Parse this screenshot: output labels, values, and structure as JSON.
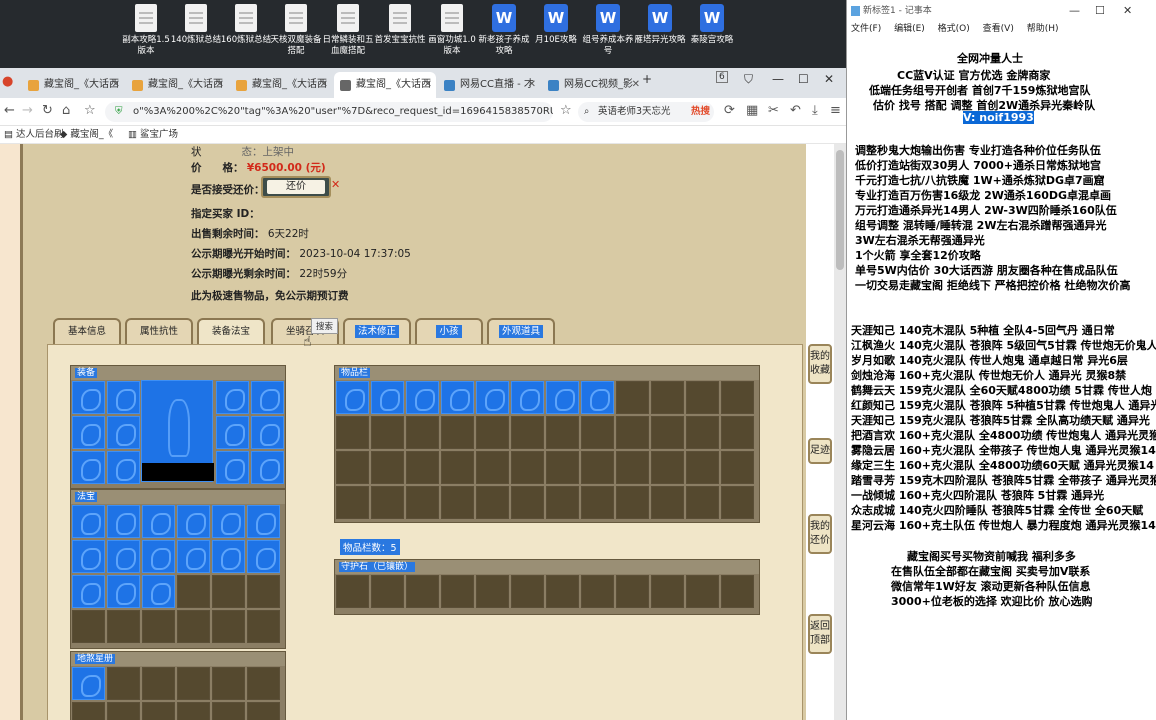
{
  "desktop": {
    "icons": [
      {
        "label": "副本攻略1.5版本",
        "kind": "doc"
      },
      {
        "label": "140炼狱总结",
        "kind": "doc"
      },
      {
        "label": "160炼狱总结",
        "kind": "doc"
      },
      {
        "label": "天核双魔装备搭配",
        "kind": "doc"
      },
      {
        "label": "日常鳞装和五血魔搭配",
        "kind": "doc"
      },
      {
        "label": "首发宝宝抗性",
        "kind": "doc"
      },
      {
        "label": "画窗功城1.0版本",
        "kind": "doc"
      },
      {
        "label": "新老孩子养成攻略",
        "kind": "wps"
      },
      {
        "label": "月10E攻略",
        "kind": "wps"
      },
      {
        "label": "组号养成本养号",
        "kind": "wps"
      },
      {
        "label": "雁塔异光攻略",
        "kind": "wps"
      },
      {
        "label": "秦陵宫攻略",
        "kind": "wps"
      }
    ]
  },
  "browser": {
    "tabs": [
      {
        "label": "藏宝阁_《大话西",
        "active": false
      },
      {
        "label": "藏宝阁_《大话西",
        "active": false
      },
      {
        "label": "藏宝阁_《大话西",
        "active": false
      },
      {
        "label": "藏宝阁_《大话西",
        "active": true
      },
      {
        "label": "网易CC直播 - 才",
        "active": false
      },
      {
        "label": "网易CC视频_影",
        "active": false
      }
    ],
    "tab_count": "6",
    "url": "o\"%3A%200%2C%20\"tag\"%3A%20\"user\"%7D&reco_request_id=1696415838570RUbxu",
    "search_text": "英语老师3天忘光",
    "search_badge": "热搜",
    "bookmarks": [
      "达人后台刷",
      "藏宝阁_《",
      "鲨宝广场"
    ]
  },
  "listing": {
    "status_label": "状",
    "status_value": "态：上架中",
    "price_label": "价　　格：",
    "price_value": "¥6500.00 (元)",
    "haggle_label": "是否接受还价：",
    "haggle_button": "还价",
    "buyer_label": "指定买家 ID：",
    "remaining_label": "出售剩余时间：",
    "remaining_value": "6天22时",
    "public_start_label": "公示期曝光开始时间：",
    "public_start_value": "2023-10-04 17:37:05",
    "public_remain_label": "公示期曝光剩余时间：",
    "public_remain_value": "22时59分",
    "fast_sale_note": "此为极速售物品，免公示期预订费"
  },
  "game_tabs": [
    {
      "label": "基本信息",
      "selected": false
    },
    {
      "label": "属性抗性",
      "selected": false
    },
    {
      "label": "装备法宝",
      "selected": false,
      "active": true
    },
    {
      "label": "坐骑召唤",
      "selected": false
    },
    {
      "label": "法术修正",
      "selected": true
    },
    {
      "label": "小孩",
      "selected": true
    },
    {
      "label": "外观道具",
      "selected": true
    }
  ],
  "tooltip": "搜索",
  "sections": {
    "equipment": "装备",
    "treasure": "法宝",
    "pet_book": "地煞星册",
    "inventory": "物品栏",
    "inventory_count": "物品栏数：5",
    "guard_stone": "守护石（已镶嵌）"
  },
  "side_buttons": [
    "我的收藏",
    "足迹",
    "我的还价",
    "返回顶部"
  ],
  "notepad": {
    "title": "新标签1 - 记事本",
    "menu": [
      "文件(F)",
      "编辑(E)",
      "格式(O)",
      "查看(V)",
      "帮助(H)"
    ],
    "lines": [
      {
        "text": "全网冲量人士",
        "highlight": false
      },
      {
        "text": "CC蓝V认证 官方优选 金牌商家",
        "highlight": false
      },
      {
        "text": "低端任务组号开创者          首创7千159炼狱地宫队",
        "highlight": false
      },
      {
        "text": "估价 找号 搭配 调整          首创2W通杀异光秦岭队",
        "highlight": false
      },
      {
        "text": "V: noif1993",
        "highlight": true
      },
      {
        "text": "调整秒鬼大炮输出伤害              专业打造各种价位任务队伍",
        "highlight": false
      },
      {
        "text": "低价打造站街双30男人              7000+通杀日常炼狱地宫",
        "highlight": false
      },
      {
        "text": "千元打造七抗/八抗铁魔            1W+通杀炼狱DG卓7画窟",
        "highlight": false
      },
      {
        "text": "专业打造百万伤害16级龙            2W通杀160DG卓混卓画",
        "highlight": false
      },
      {
        "text": "万元打造通杀异光14男人          2W-3W四阶睡杀160队伍",
        "highlight": false
      },
      {
        "text": "组号调整 混转睡/睡转混            2W左右混杀蹭帮强通异光",
        "highlight": false
      },
      {
        "text": "                                                3W左右混杀无帮强通异光",
        "highlight": false
      },
      {
        "text": "1个火箭 享全套12价攻略",
        "highlight": false
      },
      {
        "text": "单号5W内估价 30大话西游            朋友圈各种在售成品队伍",
        "highlight": false
      },
      {
        "text": "一切交易走藏宝阁 拒绝线下      严格把控价格 杜绝物次价高",
        "highlight": false
      },
      {
        "text": "天涯知己 140克木混队 5种植 全队4-5回气丹 通日常",
        "highlight": false
      },
      {
        "text": "江枫渔火 140克火混队 苍狼阵 5级回气5甘霖 传世炮无价鬼人",
        "highlight": false
      },
      {
        "text": "岁月如歌 140克火混队 传世人炮鬼 通卓越日常 异光6层",
        "highlight": false
      },
      {
        "text": "剑烛沧海 160+克火混队 传世炮无价人 通异光 灵猴8禁",
        "highlight": false
      },
      {
        "text": "鹤舞云天 159克火混队 全60天赋4800功绩 5甘霖 传世人炮",
        "highlight": false
      },
      {
        "text": "红颜知己 159克火混队 苍狼阵 5种植5甘霖 传世炮鬼人 通异光",
        "highlight": false
      },
      {
        "text": "天涯知己 159克火混队 苍狼阵5甘霖 全队高功绩天赋 通异光",
        "highlight": false
      },
      {
        "text": "把酒言欢 160+克火混队 全4800功绩 传世炮鬼人 通异光灵猴",
        "highlight": false
      },
      {
        "text": "雾隐云居 160+克火混队 全带孩子 传世炮人鬼 通异光灵猴14",
        "highlight": false
      },
      {
        "text": "缘定三生 160+克火混队 全4800功绩60天赋 通异光灵猴14",
        "highlight": false
      },
      {
        "text": "踏雪寻芳 159克木四阶混队 苍狼阵5甘霖 全带孩子 通异光灵猴",
        "highlight": false
      },
      {
        "text": "一战倾城 160+克火四阶混队 苍狼阵 5甘霖 通异光",
        "highlight": false
      },
      {
        "text": "众志成城 140克火四阶睡队 苍狼阵5甘霖 全传世 全60天赋",
        "highlight": false
      },
      {
        "text": "星河云海 160+克土队伍 传世炮人 暴力程度炮 通异光灵猴14",
        "highlight": false
      },
      {
        "text": "藏宝阁买号买物资前喊我 福利多多",
        "highlight": false
      },
      {
        "text": "在售队伍全部都在藏宝阁 买卖号加V联系",
        "highlight": false
      },
      {
        "text": "微信常年1W好友 滚动更新各种队伍信息",
        "highlight": false
      },
      {
        "text": "3000+位老板的选择 欢迎比价 放心选购",
        "highlight": false
      }
    ]
  }
}
